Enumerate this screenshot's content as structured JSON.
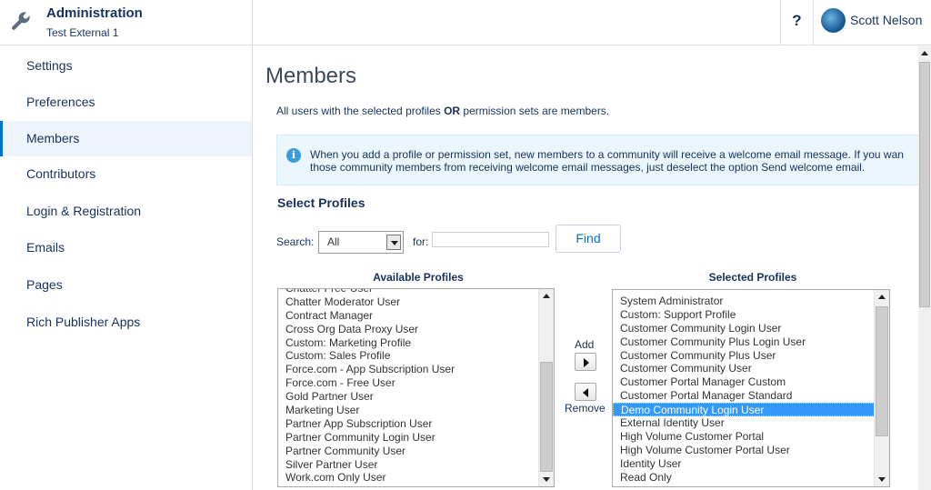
{
  "header": {
    "title": "Administration",
    "subtitle": "Test External 1",
    "help_label": "?",
    "user_name": "Scott Nelson"
  },
  "sidebar": {
    "items": [
      {
        "label": "Settings",
        "active": false
      },
      {
        "label": "Preferences",
        "active": false
      },
      {
        "label": "Members",
        "active": true
      },
      {
        "label": "Contributors",
        "active": false
      },
      {
        "label": "Login & Registration",
        "active": false
      },
      {
        "label": "Emails",
        "active": false
      },
      {
        "label": "Pages",
        "active": false
      },
      {
        "label": "Rich Publisher Apps",
        "active": false
      }
    ]
  },
  "main": {
    "title": "Members",
    "desc_pre": "All users with the selected profiles ",
    "desc_bold": "OR",
    "desc_post": " permission sets are members.",
    "info_line1": "When you add a profile or permission set, new members to a community will receive a welcome email message. If you wan",
    "info_line2": "those community members from receiving welcome email messages, just deselect the option Send welcome email.",
    "section_title": "Select Profiles",
    "search_label": "Search:",
    "search_selected": "All",
    "for_label": "for:",
    "for_value": "",
    "find_label": "Find",
    "available_header": "Available Profiles",
    "selected_header": "Selected Profiles",
    "add_label": "Add",
    "remove_label": "Remove",
    "available_profiles": [
      "Chatter Free User",
      "Chatter Moderator User",
      "Contract Manager",
      "Cross Org Data Proxy User",
      "Custom: Marketing Profile",
      "Custom: Sales Profile",
      "Force.com - App Subscription User",
      "Force.com - Free User",
      "Gold Partner User",
      "Marketing User",
      "Partner App Subscription User",
      "Partner Community Login User",
      "Partner Community User",
      "Silver Partner User",
      "Work.com Only User"
    ],
    "selected_profiles": [
      "System Administrator",
      "Custom: Support Profile",
      "Customer Community Login User",
      "Customer Community Plus Login User",
      "Customer Community Plus User",
      "Customer Community User",
      "Customer Portal Manager Custom",
      "Customer Portal Manager Standard",
      "Demo Community Login User",
      "External Identity User",
      "High Volume Customer Portal",
      "High Volume Customer Portal User",
      "Identity User",
      "Read Only"
    ],
    "selected_highlight": "Demo Community Login User"
  },
  "colors": {
    "accent": "#0070d2",
    "text": "#16325c",
    "highlight": "#3399ff"
  }
}
